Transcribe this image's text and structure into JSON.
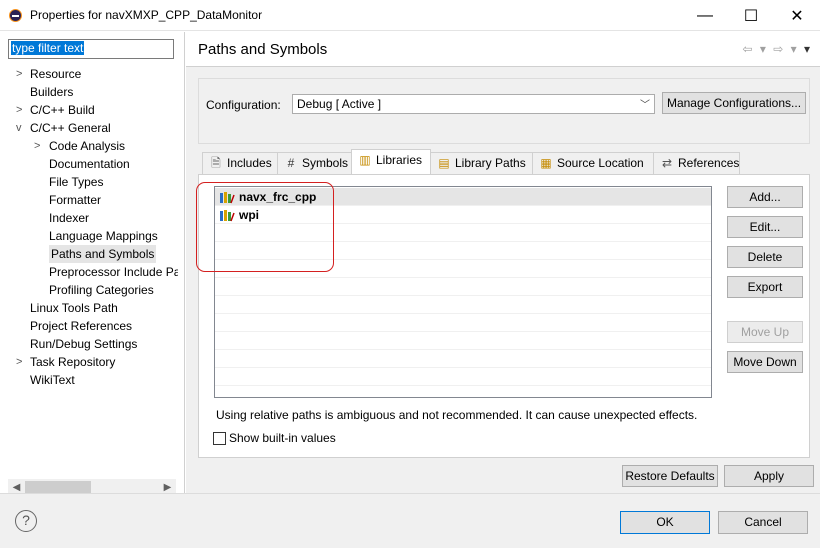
{
  "window": {
    "title": "Properties for navXMXP_CPP_DataMonitor",
    "minimize": "—",
    "maximize": "☐",
    "close": "✕"
  },
  "filter": {
    "text": "type filter text"
  },
  "tree": [
    {
      "label": "Resource",
      "twisty": ">"
    },
    {
      "label": "Builders",
      "twisty": ""
    },
    {
      "label": "C/C++ Build",
      "twisty": ">"
    },
    {
      "label": "C/C++ General",
      "twisty": "v"
    },
    {
      "label": "Code Analysis",
      "twisty": ">"
    },
    {
      "label": "Documentation",
      "twisty": ""
    },
    {
      "label": "File Types",
      "twisty": ""
    },
    {
      "label": "Formatter",
      "twisty": ""
    },
    {
      "label": "Indexer",
      "twisty": ""
    },
    {
      "label": "Language Mappings",
      "twisty": ""
    },
    {
      "label": "Paths and Symbols",
      "twisty": "",
      "selected": true
    },
    {
      "label": "Preprocessor Include Pa",
      "twisty": ""
    },
    {
      "label": "Profiling Categories",
      "twisty": ""
    },
    {
      "label": "Linux Tools Path",
      "twisty": ""
    },
    {
      "label": "Project References",
      "twisty": ""
    },
    {
      "label": "Run/Debug Settings",
      "twisty": ""
    },
    {
      "label": "Task Repository",
      "twisty": ">"
    },
    {
      "label": "WikiText",
      "twisty": ""
    }
  ],
  "page": {
    "title": "Paths and Symbols",
    "nav": {
      "back": "⇦",
      "fwd": "⇨",
      "dropdown": "▾",
      "menu": "▾"
    }
  },
  "config": {
    "label": "Configuration:",
    "value": "Debug  [ Active ]",
    "manage_label": "Manage Configurations..."
  },
  "tabs": [
    {
      "label": "Includes",
      "icon": "include-file-icon"
    },
    {
      "label": "Symbols",
      "icon": "hash-icon"
    },
    {
      "label": "Libraries",
      "icon": "library-icon",
      "active": true
    },
    {
      "label": "Library Paths",
      "icon": "library-folder-icon"
    },
    {
      "label": "Source Location",
      "icon": "source-folder-icon"
    },
    {
      "label": "References",
      "icon": "references-icon"
    }
  ],
  "libraries": [
    {
      "name": "navx_frc_cpp",
      "selected": true
    },
    {
      "name": "wpi",
      "selected": false
    }
  ],
  "side_buttons": {
    "add": "Add...",
    "edit": "Edit...",
    "delete": "Delete",
    "export": "Export",
    "move_up": "Move Up",
    "move_down": "Move Down"
  },
  "warning": "Using relative paths is ambiguous and not recommended. It can cause unexpected effects.",
  "show_builtin": {
    "label": "Show built-in values",
    "checked": false
  },
  "bottom": {
    "restore": "Restore Defaults",
    "apply": "Apply",
    "ok": "OK",
    "cancel": "Cancel",
    "help": "?"
  },
  "colors": {
    "accent": "#0078d7",
    "annotation": "#d42020",
    "selected_row": "#e5e5e5"
  }
}
